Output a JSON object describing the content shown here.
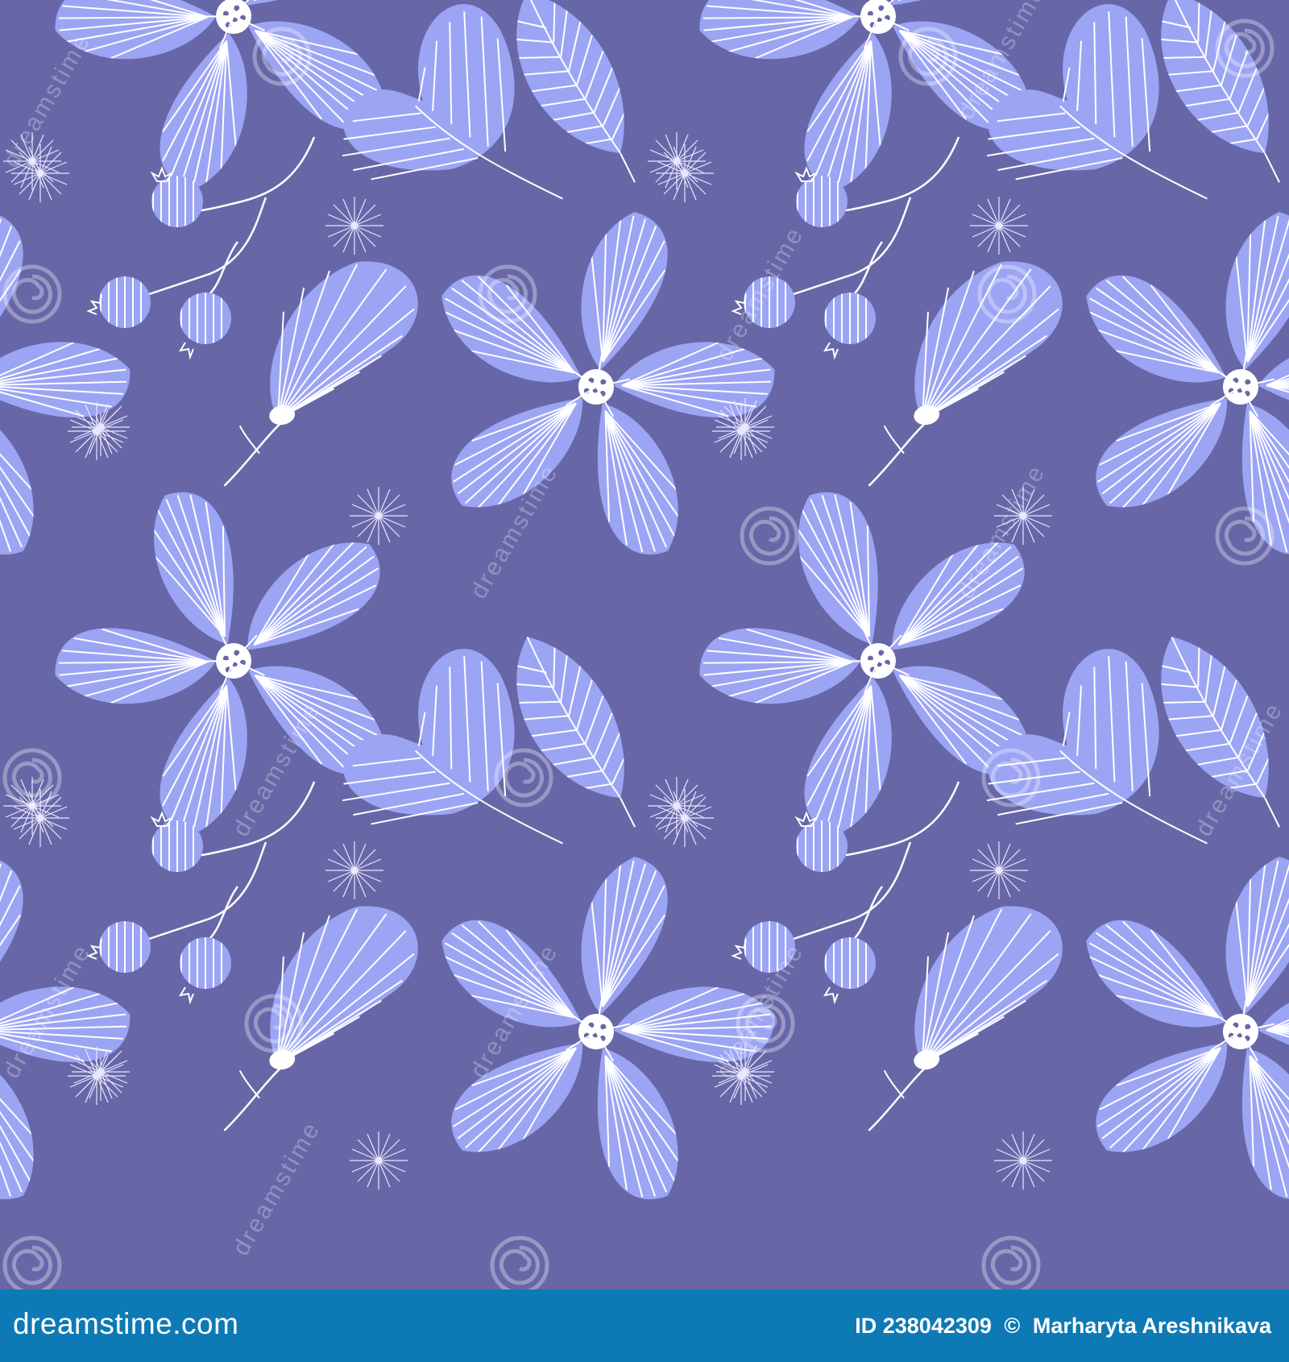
{
  "image": {
    "background_color": "#6767a8",
    "petal_color": "#9ca5f4",
    "line_color": "#ffffff",
    "watermark_text": "dreamstime"
  },
  "footer": {
    "brand_label": "dreamstime.com",
    "id_label": "ID 238042309",
    "copyright_symbol": "©",
    "author": "Marharyta Areshnikava",
    "background_color": "#0d7ab5"
  }
}
